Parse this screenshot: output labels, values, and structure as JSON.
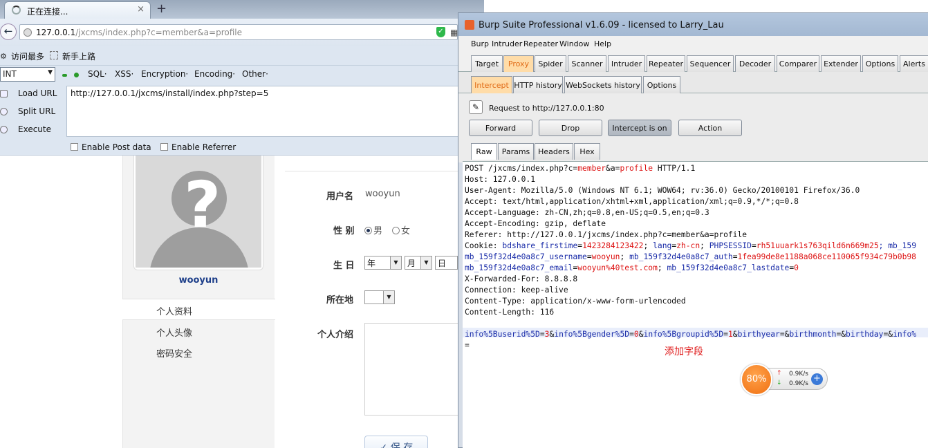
{
  "firefox": {
    "tab_title": "正在连接...",
    "tab_close": "×",
    "new_tab": "+",
    "back": "←",
    "url_host": "127.0.0.1",
    "url_path": "/jxcms/index.php?c=member&a=profile",
    "bookmarks": [
      "访问最多",
      "新手上路"
    ],
    "hackbar": {
      "int_label": "INT",
      "menus": [
        "SQL·",
        "XSS·",
        "Encryption·",
        "Encoding·",
        "Other·"
      ],
      "actions": [
        "Load URL",
        "Split URL",
        "Execute"
      ],
      "url_value": "http://127.0.0.1/jxcms/install/index.php?step=5",
      "enable_post": "Enable Post data",
      "enable_referrer": "Enable Referrer"
    }
  },
  "page": {
    "username": "wooyun",
    "nav": [
      "个人资料",
      "个人头像",
      "密码安全"
    ],
    "form": {
      "username_label": "用户名",
      "username_value": "wooyun",
      "gender_label": "性 别",
      "gender_male": "男",
      "gender_female": "女",
      "birthday_label": "生 日",
      "year": "年",
      "month": "月",
      "day": "日",
      "location_label": "所在地",
      "intro_label": "个人介绍",
      "save": "✓ 保 存"
    }
  },
  "burp": {
    "title": "Burp Suite Professional v1.6.09 - licensed to Larry_Lau",
    "menu": [
      "Burp",
      "Intruder",
      "Repeater",
      "Window",
      "Help"
    ],
    "tabs": [
      "Target",
      "Proxy",
      "Spider",
      "Scanner",
      "Intruder",
      "Repeater",
      "Sequencer",
      "Decoder",
      "Comparer",
      "Extender",
      "Options",
      "Alerts"
    ],
    "subtabs": [
      "Intercept",
      "HTTP history",
      "WebSockets history",
      "Options"
    ],
    "request_label": "Request to http://127.0.0.1:80",
    "buttons": [
      "Forward",
      "Drop",
      "Intercept is on",
      "Action"
    ],
    "view_tabs": [
      "Raw",
      "Params",
      "Headers",
      "Hex"
    ],
    "request": {
      "l1a": "POST /jxcms/index.php?c=",
      "l1b": "member",
      "l1c": "&a=",
      "l1d": "profile",
      "l1e": " HTTP/1.1",
      "l2": "Host: 127.0.0.1",
      "l3": "User-Agent: Mozilla/5.0 (Windows NT 6.1; WOW64; rv:36.0) Gecko/20100101 Firefox/36.0",
      "l4": "Accept: text/html,application/xhtml+xml,application/xml;q=0.9,*/*;q=0.8",
      "l5": "Accept-Language: zh-CN,zh;q=0.8,en-US;q=0.5,en;q=0.3",
      "l6": "Accept-Encoding: gzip, deflate",
      "l7": "Referer: http://127.0.0.1/jxcms/index.php?c=member&a=profile",
      "c1": "Cookie: ",
      "c2": "bdshare_firstime",
      "c3": "=",
      "c4": "1423284123422",
      "c5": "; ",
      "c6": "lang",
      "c7": "=",
      "c8": "zh-cn",
      "c9": "; ",
      "c10": "PHPSESSID",
      "c11": "=",
      "c12": "rh51uuark1s763qild6n669m25",
      "c13": "; mb_159",
      "m1": "mb_159f32d4e0a8c7_username",
      "m2": "=",
      "m3": "wooyun",
      "m4": "; ",
      "m5": "mb_159f32d4e0a8c7_auth",
      "m6": "=",
      "m7": "1fea99de8e1188a068ce110065f934c79b0b98",
      "e1": "mb_159f32d4e0a8c7_email",
      "e2": "=",
      "e3": "wooyun%40test.com",
      "e4": "; ",
      "e5": "mb_159f32d4e0a8c7_lastdate",
      "e6": "=",
      "e7": "0",
      "l11": "X-Forwarded-For: 8.8.8.8",
      "l12": "Connection: keep-alive",
      "l13": "Content-Type: application/x-www-form-urlencoded",
      "l14": "Content-Length: 116",
      "p1": "info%5Buserid%5D",
      "p2": "=",
      "p3": "3",
      "p4": "&",
      "p5": "info%5Bgender%5D",
      "p6": "=",
      "p7": "0",
      "p8": "&",
      "p9": "info%5Bgroupid%5D",
      "p10": "=",
      "p11": "1",
      "p12": "&",
      "p13": "birthyear",
      "p14": "=&",
      "p15": "birthmonth",
      "p16": "=&",
      "p17": "birthday",
      "p18": "=&",
      "p19": "info%",
      "p20": "="
    },
    "annotation": "添加字段"
  },
  "speed_widget": {
    "percent": "80%",
    "up_arrow": "↑",
    "down_arrow": "↓",
    "up": "0.9K/s",
    "down": "0.9K/s",
    "plus": "+"
  },
  "colors": {
    "burp_orange": "#e06a15",
    "param_blue": "#1a2ca8",
    "value_red": "#d11"
  }
}
